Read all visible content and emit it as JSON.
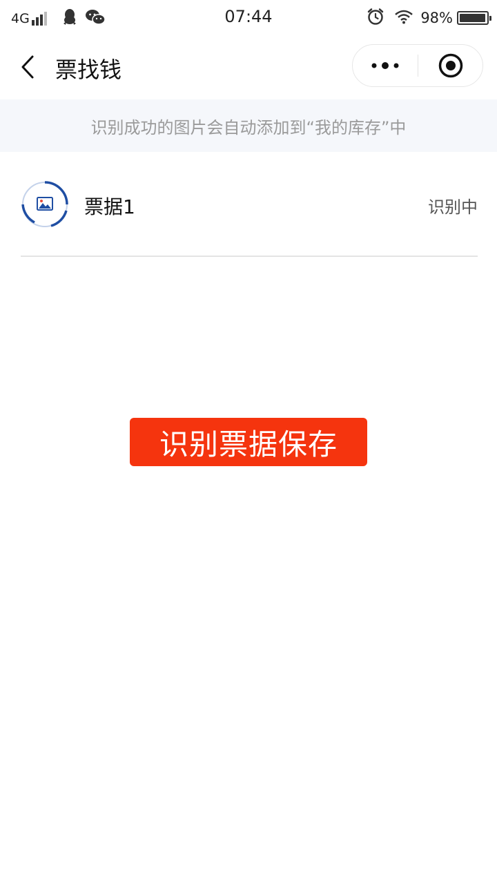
{
  "status_bar": {
    "network": "4G",
    "time": "07:44",
    "battery_percent": "98%",
    "battery_level": 0.98,
    "icons": [
      "signal-icon",
      "qq-icon",
      "wechat-icon",
      "alarm-icon",
      "wifi-icon",
      "battery-icon"
    ]
  },
  "nav": {
    "title": "票找钱",
    "back_icon": "back-arrow-icon",
    "more_icon": "more-dots-icon",
    "close_icon": "close-circle-icon"
  },
  "notice": {
    "text": "识别成功的图片会自动添加到“我的库存”中"
  },
  "tickets": [
    {
      "name": "票据1",
      "status": "识别中",
      "icon": "image-loading-icon"
    }
  ],
  "actions": {
    "save_label": "识别票据保存"
  },
  "colors": {
    "accent": "#f5340e",
    "notice_bg": "#f5f7fb",
    "icon_blue": "#1f4ea3"
  }
}
